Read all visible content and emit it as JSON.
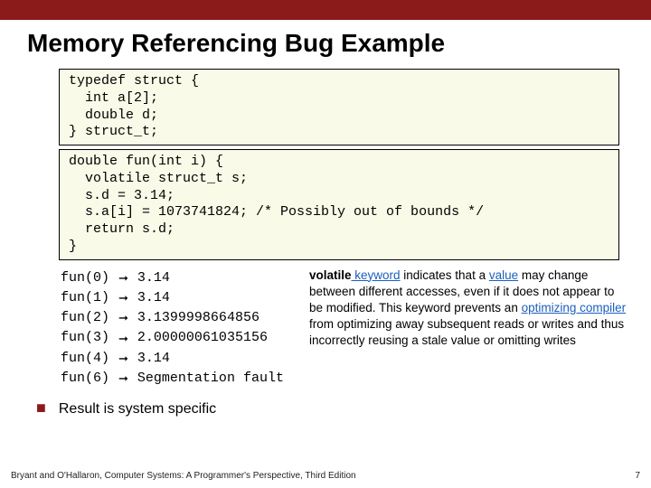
{
  "title": "Memory Referencing Bug Example",
  "code1": "typedef struct {\n  int a[2];\n  double d;\n} struct_t;",
  "code2": "double fun(int i) {\n  volatile struct_t s;\n  s.d = 3.14;\n  s.a[i] = 1073741824; /* Possibly out of bounds */\n  return s.d;\n}",
  "results": [
    {
      "call": "fun(0)",
      "out": "3.14"
    },
    {
      "call": "fun(1)",
      "out": "3.14"
    },
    {
      "call": "fun(2)",
      "out": "3.1399998664856"
    },
    {
      "call": "fun(3)",
      "out": "2.00000061035156"
    },
    {
      "call": "fun(4)",
      "out": "3.14"
    },
    {
      "call": "fun(6)",
      "out": "Segmentation fault"
    }
  ],
  "bullet_text": "Result is system specific",
  "explain": {
    "pre_bold": "",
    "bold": "volatile",
    "kw": " keyword",
    "mid1": " indicates that a ",
    "valword": "value",
    "mid2": " may change between different accesses, even if it does not appear to be modified. This keyword prevents an ",
    "opt": "optimizing compiler",
    "mid3": " from optimizing away subsequent reads or writes and thus incorrectly reusing a stale value or omitting writes"
  },
  "footer_left": "Bryant and O'Hallaron, Computer Systems: A Programmer's Perspective, Third Edition",
  "footer_right": "7"
}
